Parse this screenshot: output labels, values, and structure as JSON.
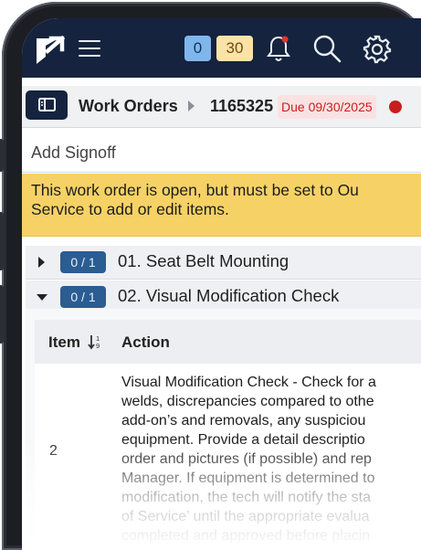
{
  "topbar": {
    "counts": {
      "open": "0",
      "pending": "30"
    }
  },
  "breadcrumb": {
    "section": "Work Orders",
    "work_order_id": "1165325",
    "due": "Due 09/30/2025"
  },
  "signoff": {
    "label": "Add Signoff"
  },
  "warning": {
    "line1": "This work order is open, but must be set to Ou",
    "line2": "Service to add or edit items."
  },
  "sections": [
    {
      "progress": "0 / 1",
      "title": "01. Seat Belt Mounting",
      "expanded": false
    },
    {
      "progress": "0 / 1",
      "title": "02. Visual Modification Check",
      "expanded": true
    }
  ],
  "table": {
    "headers": {
      "item": "Item",
      "action": "Action"
    },
    "rows": [
      {
        "item": "2",
        "action_lines": [
          "Visual Modification Check - Check for a",
          "welds, discrepancies compared to othe",
          "add-on’s and removals, any suspiciou",
          "equipment. Provide a detail descriptio",
          "order and pictures (if possible) and rep",
          "Manager. If equipment is determined to",
          "modification, the tech will notify the sta",
          "of Service’ until the appropriate evalua",
          "completed and approved before placin"
        ]
      }
    ]
  },
  "colors": {
    "navbar": "#15233e",
    "warning": "#f6d266",
    "badge": "#2b5c92",
    "due": "#c81e1e"
  }
}
